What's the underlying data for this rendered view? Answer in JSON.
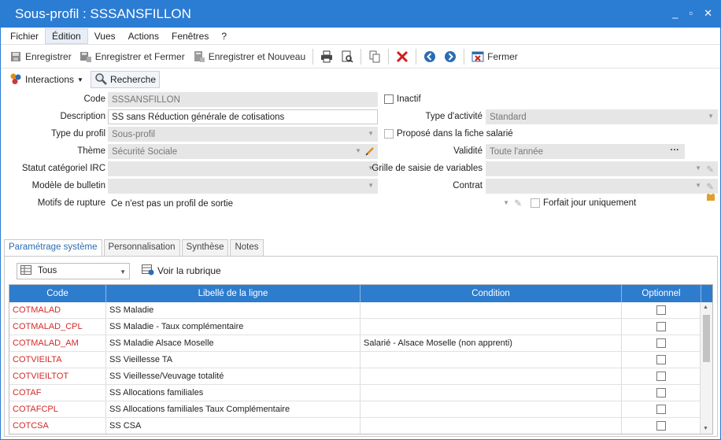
{
  "window": {
    "title": "Sous-profil : SSSANSFILLON",
    "controls": [
      "_",
      "▫",
      "✕"
    ]
  },
  "menubar": {
    "items": [
      "Fichier",
      "Édition",
      "Vues",
      "Actions",
      "Fenêtres",
      "?"
    ]
  },
  "toolbar": {
    "save": "Enregistrer",
    "save_close": "Enregistrer et Fermer",
    "save_new": "Enregistrer et Nouveau",
    "close": "Fermer"
  },
  "toolbar2": {
    "interactions": "Interactions",
    "search": "Recherche"
  },
  "form": {
    "code_label": "Code",
    "code_value": "SSSANSFILLON",
    "inactif_label": "Inactif",
    "description_label": "Description",
    "description_value": "SS sans Réduction générale de cotisations",
    "type_activite_label": "Type d'activité",
    "type_activite_value": "Standard",
    "type_profil_label": "Type du profil",
    "type_profil_value": "Sous-profil",
    "propose_label": "Proposé dans la fiche salarié",
    "theme_label": "Thème",
    "theme_value": "Sécurité Sociale",
    "validite_label": "Validité",
    "validite_value": "Toute l'année",
    "statut_label": "Statut catégoriel IRC",
    "grille_label": "Grille de saisie de variables",
    "modele_label": "Modèle de bulletin",
    "contrat_label": "Contrat",
    "motifs_label": "Motifs de rupture",
    "motifs_value": "Ce n'est pas un profil de sortie",
    "forfait_label": "Forfait jour uniquement"
  },
  "tabs": [
    "Paramétrage système",
    "Personnalisation",
    "Synthèse",
    "Notes"
  ],
  "grid_toolbar": {
    "filter_value": "Tous",
    "voir_rubrique": "Voir la rubrique"
  },
  "grid": {
    "columns": [
      "Code",
      "Libellé de la ligne",
      "Condition",
      "Optionnel"
    ],
    "rows": [
      {
        "code": "COTMALAD",
        "libelle": "SS Maladie",
        "condition": ""
      },
      {
        "code": "COTMALAD_CPL",
        "libelle": "SS Maladie - Taux complémentaire",
        "condition": ""
      },
      {
        "code": "COTMALAD_AM",
        "libelle": "SS Maladie Alsace Moselle",
        "condition": "Salarié - Alsace Moselle (non apprenti)"
      },
      {
        "code": "COTVIEILTA",
        "libelle": "SS Vieillesse TA",
        "condition": ""
      },
      {
        "code": "COTVIEILTOT",
        "libelle": "SS Vieillesse/Veuvage totalité",
        "condition": ""
      },
      {
        "code": "COTAF",
        "libelle": "SS Allocations familiales",
        "condition": ""
      },
      {
        "code": "COTAFCPL",
        "libelle": "SS Allocations familiales Taux Complémentaire",
        "condition": ""
      },
      {
        "code": "COTCSA",
        "libelle": "SS CSA",
        "condition": ""
      }
    ]
  }
}
